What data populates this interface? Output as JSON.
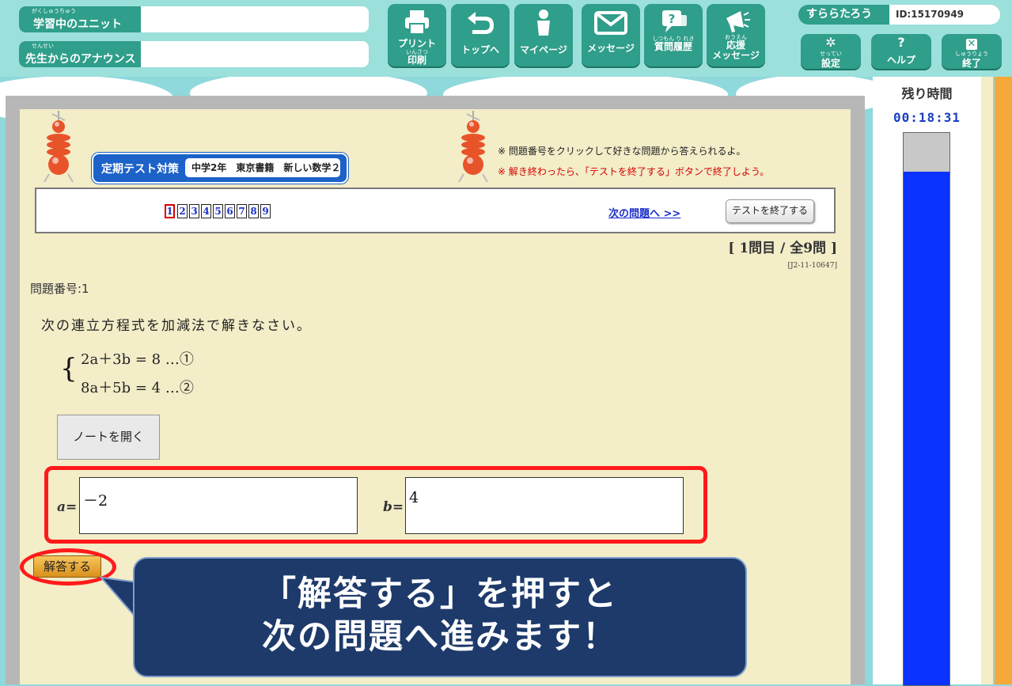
{
  "header": {
    "unit_label": "学習中のユニット",
    "unit_ruby": "がくしゅうちゅう",
    "unit_value": "",
    "announce_label": "先生からのアナウンス",
    "announce_ruby": "せんせい",
    "announce_value": "",
    "buttons": [
      {
        "label_1": "プリント",
        "ruby": "いんさつ",
        "label_2": "印刷",
        "icon": "printer-icon"
      },
      {
        "label_1": "トップへ",
        "icon": "return-arrow-icon"
      },
      {
        "label_1": "マイページ",
        "icon": "person-icon"
      },
      {
        "label_1": "メッセージ",
        "icon": "envelope-icon"
      },
      {
        "label_1": "質問履歴",
        "ruby": "しつもん り れき",
        "icon": "question-chat-icon"
      },
      {
        "label_1": "応援",
        "ruby": "おうえん",
        "label_2": "メッセージ",
        "icon": "megaphone-icon"
      }
    ],
    "user_name": "すららたろう",
    "user_id": "ID:15170949",
    "settings_label": "設定",
    "settings_ruby": "せってい",
    "help_label": "ヘルプ",
    "end_label": "終了",
    "end_ruby": "しゅうりょう"
  },
  "timer": {
    "title": "残り時間",
    "value": "00:18:31",
    "remaining_fraction": 0.93
  },
  "test": {
    "badge_title": "定期テスト対策",
    "badge_detail": "中学2年　東京書籍　新しい数学２",
    "note_1": "※ 問題番号をクリックして好きな問題から答えられるよ。",
    "note_2": "※ 解き終わったら、「テストを終了する」ボタンで終了しよう。",
    "question_numbers": [
      "1",
      "2",
      "3",
      "4",
      "5",
      "6",
      "7",
      "8",
      "9"
    ],
    "current_question": "1",
    "next_link": "次の問題へ >>",
    "end_button": "テストを終了する",
    "count": "[ 1問目 / 全9問 ]",
    "code": "[J2-11-10647]"
  },
  "question": {
    "number_label": "問題番号:1",
    "text": "次の連立方程式を加減法で解きなさい。",
    "eq1": "2a＋3b = 8 …①",
    "eq2": "8a＋5b = 4 …②",
    "note_button": "ノートを開く",
    "a_label": "a=",
    "a_value": "－2",
    "b_label": "b=",
    "b_value": "4",
    "submit_button": "解答する"
  },
  "callout": {
    "line_1": "「解答する」を押すと",
    "line_2": "次の問題へ進みます！"
  },
  "colors": {
    "header_bg": "#9be0db",
    "button_teal": "#2f9e8a",
    "panel_bg": "#f3edc8",
    "highlight_red": "#ff1a1a",
    "callout_bg": "#1d3a6b",
    "timer_blue": "#0a33ff"
  }
}
